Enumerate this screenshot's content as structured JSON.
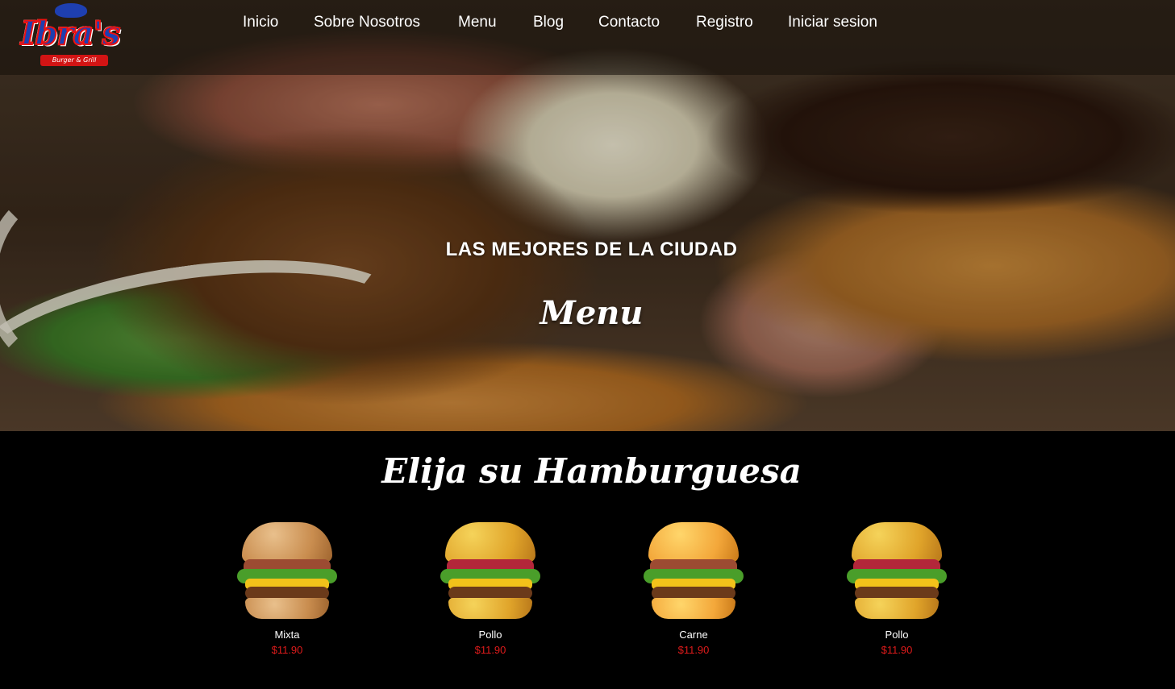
{
  "brand": {
    "logo_text": "Ibra's",
    "logo_ribbon": "Burger & Grill"
  },
  "nav": {
    "items": [
      {
        "label": "Inicio"
      },
      {
        "label": "Sobre Nosotros"
      },
      {
        "label": "Menu"
      },
      {
        "label": "Blog"
      },
      {
        "label": "Contacto"
      },
      {
        "label": "Registro"
      },
      {
        "label": "Iniciar sesion"
      }
    ]
  },
  "hero": {
    "subtitle": "LAS MEJORES DE LA CIUDAD",
    "title": "Menu"
  },
  "menu": {
    "title": "Elija su Hamburguesa",
    "products": [
      {
        "name": "Mixta",
        "price": "$11.90"
      },
      {
        "name": "Pollo",
        "price": "$11.90"
      },
      {
        "name": "Carne",
        "price": "$11.90"
      },
      {
        "name": "Pollo",
        "price": "$11.90"
      }
    ]
  },
  "colors": {
    "price": "#e01b1b",
    "background": "#000000",
    "logo_blue": "#1e3fb0",
    "logo_red": "#d21414"
  }
}
